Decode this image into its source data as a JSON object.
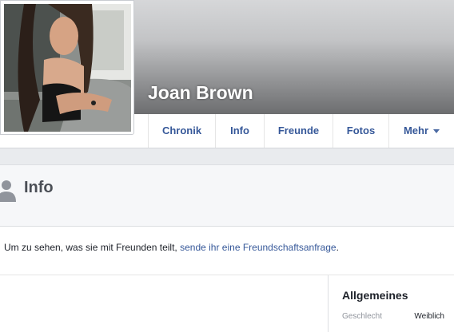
{
  "profile": {
    "name": "Joan Brown"
  },
  "nav": {
    "tabs": [
      {
        "label": "Chronik"
      },
      {
        "label": "Info"
      },
      {
        "label": "Freunde"
      },
      {
        "label": "Fotos"
      },
      {
        "label": "Mehr"
      }
    ],
    "more_icon": "caret-down-icon"
  },
  "info": {
    "title": "Info",
    "icon": "person-icon",
    "message_prefix": "Um zu sehen, was sie mit Freunden teilt,",
    "message_link": "sende ihr eine Freundschaftsanfrage",
    "message_suffix": "."
  },
  "general": {
    "title": "Allgemeines",
    "fields": [
      {
        "label": "Geschlecht",
        "value": "Weiblich"
      }
    ]
  },
  "colors": {
    "link": "#365899",
    "page_bg": "#e9ebee",
    "header_text": "#4b4f56",
    "muted": "#90949c"
  }
}
